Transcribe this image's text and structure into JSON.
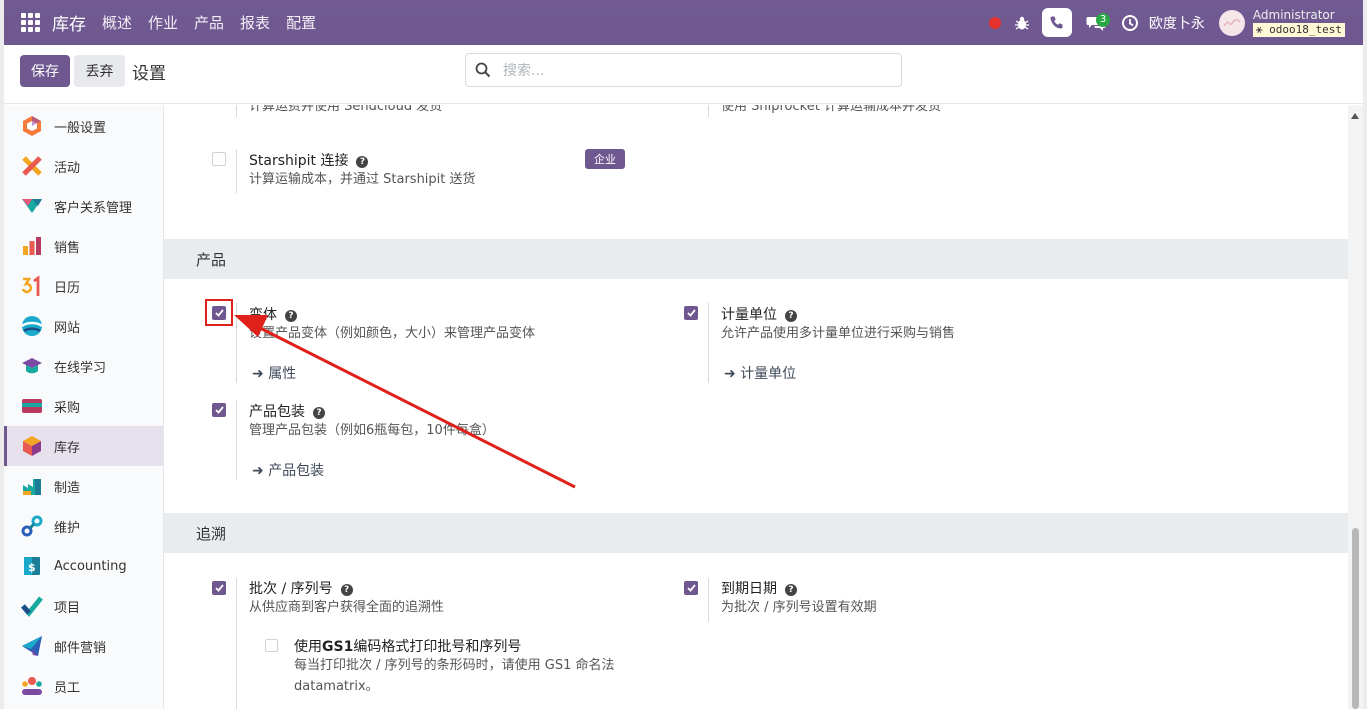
{
  "topbar": {
    "brand": "库存",
    "nav": [
      "概述",
      "作业",
      "产品",
      "报表",
      "配置"
    ],
    "chat_count": "3",
    "company": "欧度卜永",
    "user": "Administrator",
    "db": "odoo18_test"
  },
  "control": {
    "save": "保存",
    "discard": "丢弃",
    "title": "设置",
    "search_placeholder": "搜索..."
  },
  "sidebar": {
    "items": [
      {
        "label": "一般设置",
        "icon": "general-settings-icon"
      },
      {
        "label": "活动",
        "icon": "activity-icon"
      },
      {
        "label": "客户关系管理",
        "icon": "crm-icon"
      },
      {
        "label": "销售",
        "icon": "sales-icon"
      },
      {
        "label": "日历",
        "icon": "calendar-icon"
      },
      {
        "label": "网站",
        "icon": "website-icon"
      },
      {
        "label": "在线学习",
        "icon": "elearning-icon"
      },
      {
        "label": "采购",
        "icon": "purchase-icon"
      },
      {
        "label": "库存",
        "icon": "inventory-icon",
        "active": true
      },
      {
        "label": "制造",
        "icon": "manufacturing-icon"
      },
      {
        "label": "维护",
        "icon": "maintenance-icon"
      },
      {
        "label": "Accounting",
        "icon": "accounting-icon"
      },
      {
        "label": "项目",
        "icon": "project-icon"
      },
      {
        "label": "邮件营销",
        "icon": "email-marketing-icon"
      },
      {
        "label": "员工",
        "icon": "employees-icon"
      }
    ]
  },
  "shipping": {
    "sendcloud_desc": "计算运费并使用 Sendcloud 发货",
    "shiprocket_desc": "使用 Shiprocket 计算运输成本并发货",
    "starshipit_title": "Starshipit 连接",
    "starshipit_desc": "计算运输成本，并通过 Starshipit 送货",
    "enterprise_badge": "企业"
  },
  "products": {
    "header": "产品",
    "variants_title": "变体",
    "variants_desc": "设置产品变体（例如颜色，大小）来管理产品变体",
    "variants_link": "属性",
    "uom_title": "计量单位",
    "uom_desc": "允许产品使用多计量单位进行采购与销售",
    "uom_link": "计量单位",
    "packaging_title": "产品包装",
    "packaging_desc": "管理产品包装（例如6瓶每包，10件每盒）",
    "packaging_link": "产品包装"
  },
  "traceability": {
    "header": "追溯",
    "lots_title": "批次 / 序列号",
    "lots_desc": "从供应商到客户获得全面的追溯性",
    "expiry_title": "到期日期",
    "expiry_desc": "为批次 / 序列号设置有效期",
    "gs1_title_pre": "使用",
    "gs1_title_bold": "GS1",
    "gs1_title_post": "编码格式打印批号和序列号",
    "gs1_desc_1": "每当打印批次 / 序列号的条形码时，请使用 GS1 命名法",
    "gs1_desc_2": "datamatrix。"
  },
  "colors": {
    "primary": "#6f5890",
    "annotation": "#e0211b",
    "section_bg": "#e9ecef"
  }
}
